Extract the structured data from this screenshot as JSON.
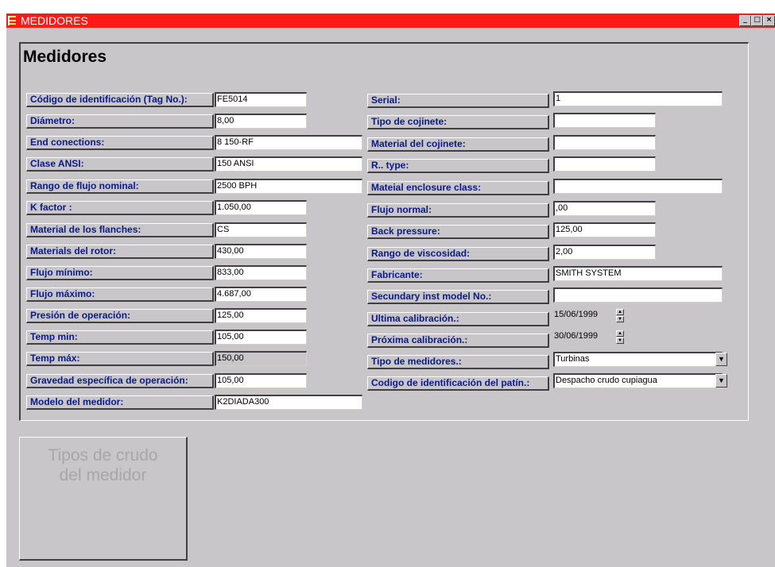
{
  "window": {
    "title": "MEDIDORES",
    "buttons": {
      "minimize": "_",
      "maximize": "□",
      "close": "×"
    }
  },
  "form": {
    "heading": "Medidores",
    "left": [
      {
        "label": "Código de identificación (Tag No.):",
        "value": "FE5014"
      },
      {
        "label": "Diámetro:",
        "value": "8,00"
      },
      {
        "label": "End conections:",
        "value": "8 150-RF"
      },
      {
        "label": "Clase ANSI:",
        "value": "150 ANSI"
      },
      {
        "label": "Rango de flujo nominal:",
        "value": "2500 BPH"
      },
      {
        "label": "K factor :",
        "value": "1.050,00"
      },
      {
        "label": "Material de los flanches:",
        "value": "CS"
      },
      {
        "label": "Materials del rotor:",
        "value": "430,00"
      },
      {
        "label": "Flujo mínimo:",
        "value": "833,00"
      },
      {
        "label": "Flujo máximo:",
        "value": "4.687,00"
      },
      {
        "label": "Presión de operación:",
        "value": "125,00"
      },
      {
        "label": "Temp min:",
        "value": "105,00"
      },
      {
        "label": "Temp máx:",
        "value": "150,00"
      },
      {
        "label": "Gravedad específica de operación:",
        "value": "105,00"
      },
      {
        "label": "Modelo del medidor:",
        "value": "K2DIADA300"
      }
    ],
    "right": [
      {
        "label": "Serial:",
        "value": "1"
      },
      {
        "label": "Tipo de cojinete:",
        "value": ""
      },
      {
        "label": "Material del cojinete:",
        "value": ""
      },
      {
        "label": "R.. type:",
        "value": ""
      },
      {
        "label": "Mateial enclosure class:",
        "value": ""
      },
      {
        "label": "Flujo normal:",
        "value": ",00"
      },
      {
        "label": "Back pressure:",
        "value": "125,00"
      },
      {
        "label": "Rango de viscosidad:",
        "value": "2,00"
      },
      {
        "label": "Fabricante:",
        "value": "SMITH SYSTEM"
      },
      {
        "label": "Secundary inst model No.:",
        "value": ""
      },
      {
        "label": "Ultima calibración.:",
        "value": "15/06/1999"
      },
      {
        "label": "Próxima calibración.:",
        "value": "30/06/1999"
      },
      {
        "label": "Tipo de medidores.:",
        "value": "Turbinas"
      },
      {
        "label": "Codigo de identificación del patín.:",
        "value": "Despacho crudo cupiagua"
      }
    ]
  },
  "crude_button": {
    "label": "Tipos de crudo\ndel medidor"
  },
  "icons": {
    "spin_up": "▲",
    "spin_down": "▼",
    "dropdown": "▼"
  },
  "colors": {
    "titlebar": "#ff1a1a",
    "label_text": "#0a1a86",
    "window_bg": "#c8c6c8"
  }
}
